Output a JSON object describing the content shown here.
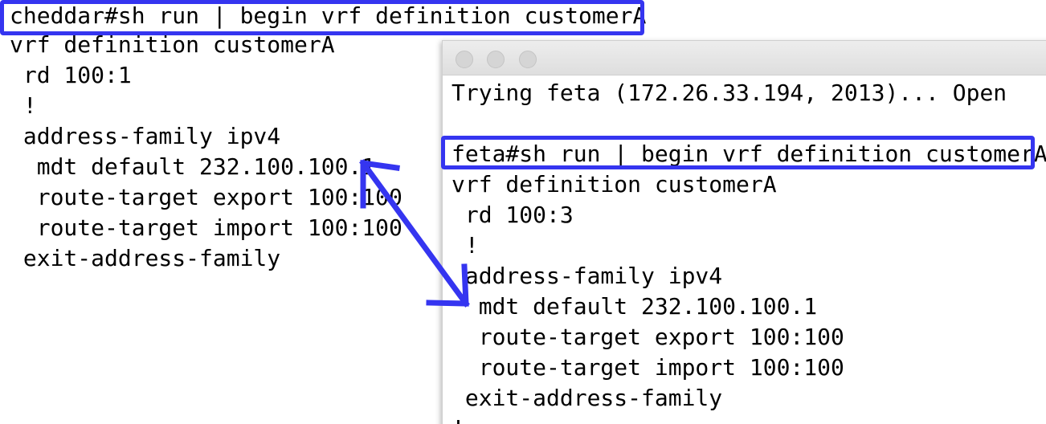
{
  "left_terminal": {
    "lines": [
      "cheddar#sh run | begin vrf definition customerA",
      "vrf definition customerA",
      " rd 100:1",
      " !",
      " address-family ipv4",
      "  mdt default 232.100.100.1",
      "  route-target export 100:100",
      "  route-target import 100:100",
      " exit-address-family"
    ]
  },
  "right_terminal": {
    "lines": [
      "Trying feta (172.26.33.194, 2013)... Open",
      "",
      "feta#sh run | begin vrf definition customerA",
      "vrf definition customerA",
      " rd 100:3",
      " !",
      " address-family ipv4",
      "  mdt default 232.100.100.1",
      "  route-target export 100:100",
      "  route-target import 100:100",
      " exit-address-family",
      "!"
    ]
  },
  "colors": {
    "annotation": "#3535f0",
    "text": "#000000",
    "window_button": "#d5d5d5"
  }
}
